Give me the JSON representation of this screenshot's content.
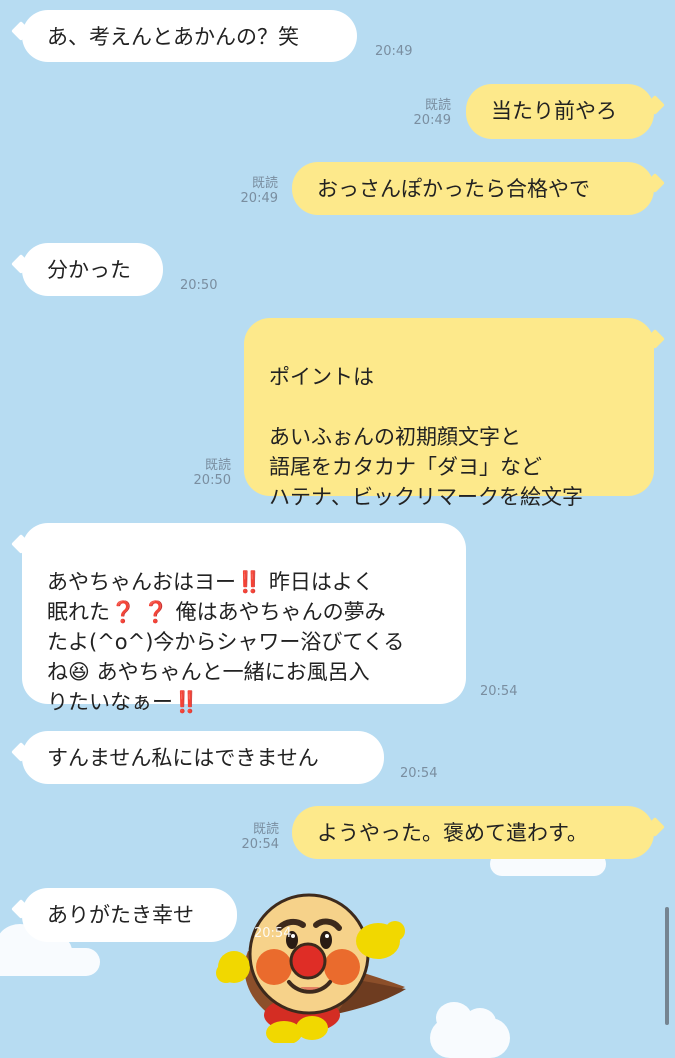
{
  "background": {
    "sky_color": "#b7dcf2",
    "bubble_in_color": "#ffffff",
    "bubble_out_color": "#fde98b"
  },
  "messages": [
    {
      "id": "m1",
      "side": "in",
      "text": "あ、考えんとあかんの？笑",
      "time": "20:49"
    },
    {
      "id": "m2",
      "side": "out",
      "text": "当たり前やろ",
      "read": "既読",
      "time": "20:49"
    },
    {
      "id": "m3",
      "side": "out",
      "text": "おっさんぽかったら合格やで",
      "read": "既読",
      "time": "20:49"
    },
    {
      "id": "m4",
      "side": "in",
      "text": "分かった",
      "time": "20:50"
    },
    {
      "id": "m5",
      "side": "out",
      "text": "ポイントは\n\nあいふぉんの初期顔文字と\n語尾をカタカナ「ダヨ」など\nハテナ、ビックリマークを絵文字",
      "read": "既読",
      "time": "20:50"
    },
    {
      "id": "m6",
      "side": "in",
      "text": "あやちゃんおはヨー‼️ 昨日はよく\n眠れた❓ ❓ 俺はあやちゃんの夢み\nたよ(^o^)今からシャワー浴びてくる\nね😆 あやちゃんと一緒にお風呂入\nりたいなぁー‼️",
      "time": "20:54"
    },
    {
      "id": "m7",
      "side": "in",
      "text": "すんません私にはできません",
      "time": "20:54"
    },
    {
      "id": "m8",
      "side": "out",
      "text": "ようやった。褒めて遣わす。",
      "read": "既読",
      "time": "20:54"
    },
    {
      "id": "m9",
      "side": "in",
      "text": "ありがたき幸せ",
      "time": ""
    }
  ],
  "sticker": {
    "icon": "anpanman-sticker-icon",
    "time": "20:54"
  }
}
